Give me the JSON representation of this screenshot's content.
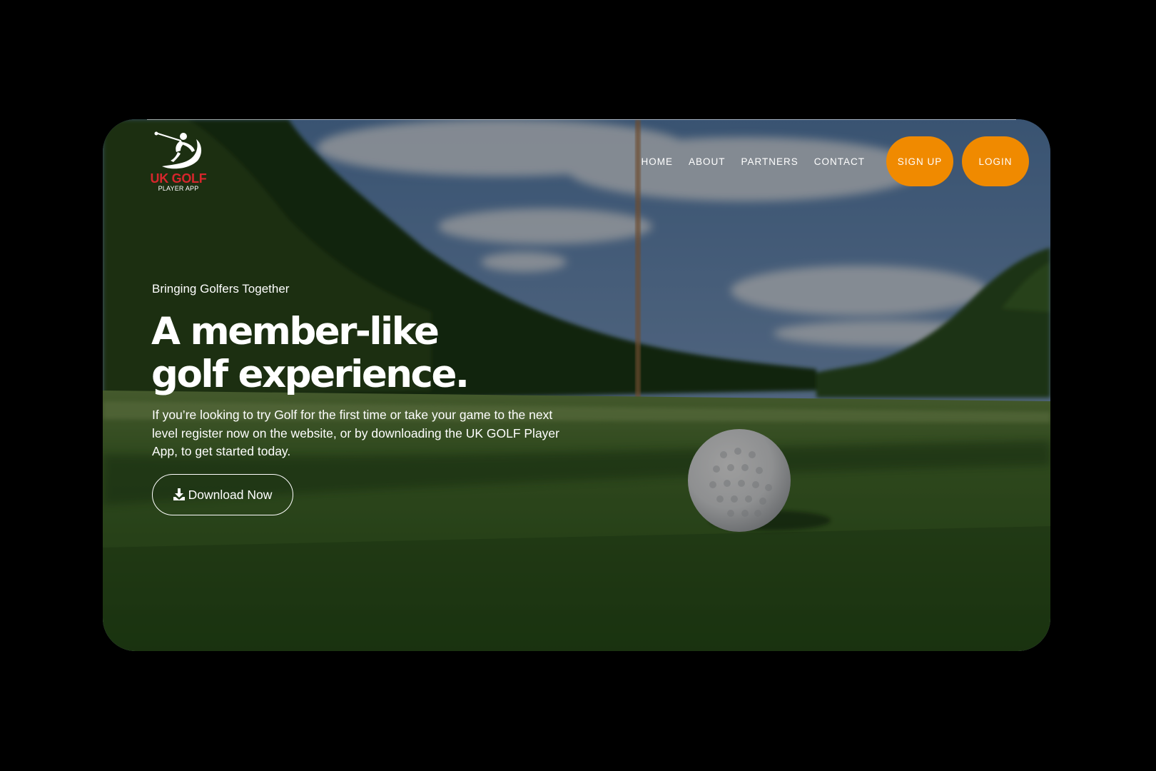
{
  "brand": {
    "logo_title": "UK GOLF",
    "logo_subtitle": "PLAYER APP",
    "logo_icon": "golfer-swing-icon",
    "logo_color": "#d7262c"
  },
  "nav": {
    "links": [
      "HOME",
      "ABOUT",
      "PARTNERS",
      "CONTACT"
    ],
    "signup_label": "SIGN UP",
    "login_label": "LOGIN",
    "accent_color": "#f08a00"
  },
  "hero": {
    "eyebrow": "Bringing Golfers Together",
    "headline_line1": "A member-like",
    "headline_line2": "golf experience.",
    "body": "If you’re looking to try Golf for the first time or take your game to the next level register now on the website, or by downloading the UK GOLF Player App, to get started today.",
    "cta_label": "Download Now",
    "cta_icon": "download-icon",
    "background": "golf-course-ball-photo"
  }
}
